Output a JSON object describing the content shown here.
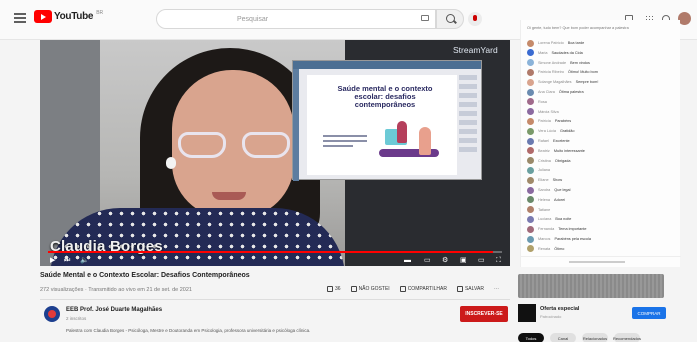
{
  "header": {
    "logo_text": "YouTube",
    "region": "BR",
    "search_placeholder": "Pesquisar"
  },
  "video": {
    "presenter_name": "Claudia Borges",
    "watermark": "StreamYard",
    "slide_title": "Saúde mental e o contexto escolar: desafios contemporâneos",
    "title": "Saúde Mental e o Contexto Escolar: Desafios Contemporâneos",
    "views": "272 visualizações · Transmitido ao vivo em 21 de set. de 2021",
    "progress_fraction": 0.98,
    "time_text": ""
  },
  "actions": [
    {
      "label": "36"
    },
    {
      "label": "NÃO GOSTEI"
    },
    {
      "label": "COMPARTILHAR"
    },
    {
      "label": "SALVAR"
    }
  ],
  "channel": {
    "name": "EEB Prof. José Duarte Magalhães",
    "subs": "2 inscritos",
    "subscribe_label": "INSCREVER-SE",
    "description": "Palestra com Claudia Borges - Psicóloga, Mestre e Doutoranda em Psicologia, professora universitária e psicóloga clínica."
  },
  "chat": {
    "header": "Oi gente, tudo bem? Que bom poder acompanhar a palestra",
    "messages": [
      {
        "author": "Lorena Patrício",
        "text": "Boa tarde",
        "color": "#c58a6a"
      },
      {
        "author": "Maria",
        "text": "Saudades da Cida",
        "color": "#3a6bd1"
      },
      {
        "author": "Simone Andrade",
        "text": "Bem vindos",
        "color": "#8bb3d9"
      },
      {
        "author": "Patrícia Ribeiro",
        "text": "Ótimo! Muito bom",
        "color": "#b07a6a"
      },
      {
        "author": "Solange Magalhães",
        "text": "Sempre bom!",
        "color": "#d9a48e"
      },
      {
        "author": "Ana Clara",
        "text": "Ótima palestra",
        "color": "#6a8bb0"
      },
      {
        "author": "Rosa",
        "text": "",
        "color": "#a06a8b"
      },
      {
        "author": "Márcia Silva",
        "text": "",
        "color": "#8b6aa0"
      },
      {
        "author": "Patrícia",
        "text": "Parabéns",
        "color": "#c58a6a"
      },
      {
        "author": "Vera Lúcia",
        "text": "Gratidão",
        "color": "#7a9a6a"
      },
      {
        "author": "Rafael",
        "text": "Excelente",
        "color": "#6a7ab0"
      },
      {
        "author": "Beatriz",
        "text": "Muito interessante",
        "color": "#b06a6a"
      },
      {
        "author": "Cristina",
        "text": "Obrigada",
        "color": "#9a8a6a"
      },
      {
        "author": "Juliana",
        "text": "",
        "color": "#6aa0a0"
      },
      {
        "author": "Eliane",
        "text": "Show",
        "color": "#a08a6a"
      },
      {
        "author": "Sandra",
        "text": "Que legal",
        "color": "#8a6aa0"
      },
      {
        "author": "Helena",
        "text": "Adorei",
        "color": "#6a8a6a"
      },
      {
        "author": "Tatiane",
        "text": "",
        "color": "#b0806a"
      },
      {
        "author": "Luciana",
        "text": "Boa noite",
        "color": "#7a7ab0"
      },
      {
        "author": "Fernanda",
        "text": "Tema importante",
        "color": "#a06a7a"
      },
      {
        "author": "Marcos",
        "text": "Parabéns pela escola",
        "color": "#6a9ab0"
      },
      {
        "author": "Renata",
        "text": "Ótimo",
        "color": "#b0a06a"
      }
    ]
  },
  "ad": {
    "title": "Oferta especial",
    "sub": "Patrocinado",
    "button": "COMPRAR"
  },
  "chips": [
    {
      "label": "Todos"
    },
    {
      "label": "Canal"
    },
    {
      "label": "Relacionados"
    },
    {
      "label": "Recomendados"
    }
  ],
  "colors": {
    "accent": "#ff0000",
    "subscribe": "#cc1a1a",
    "ad_button": "#1a73e8"
  }
}
